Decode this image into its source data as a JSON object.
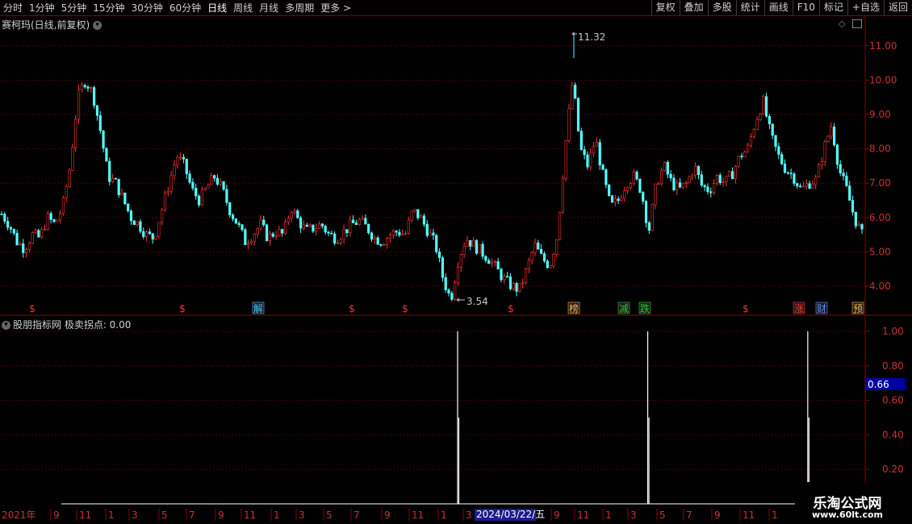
{
  "toolbar": {
    "periods": [
      "分时",
      "1分钟",
      "5分钟",
      "15分钟",
      "30分钟",
      "60分钟",
      "日线",
      "周线",
      "月线",
      "多周期",
      "更多 >"
    ],
    "active_period": "日线",
    "actions": [
      "复权",
      "叠加",
      "多股",
      "统计",
      "画线",
      "F10",
      "标记",
      "+自选",
      "返回"
    ]
  },
  "main_chart": {
    "title": "赛柯玛(日线,前复权)",
    "high_label": "11.32",
    "low_label": "3.54",
    "y_ticks": [
      "11.00",
      "10.00",
      "9.00",
      "8.00",
      "7.00",
      "6.00",
      "5.00",
      "4.00"
    ],
    "markers": [
      "$",
      "$",
      "解",
      "$",
      "$",
      "$",
      "榜",
      "减",
      "跌",
      "$",
      "涨",
      "财",
      "预"
    ]
  },
  "sub_chart": {
    "title": "股朋指标网 极卖拐点: 0.00",
    "y_ticks": [
      "1.00",
      "0.80",
      "0.60",
      "0.40",
      "0.20"
    ],
    "current_value": "0.66"
  },
  "date_axis": {
    "labels": [
      "2021年",
      "9",
      "11",
      "1",
      "3",
      "5",
      "7",
      "9",
      "11",
      "1",
      "3",
      "5",
      "7",
      "9",
      "11",
      "1",
      "3",
      "5",
      "7",
      "9",
      "11",
      "1",
      "3",
      "5",
      "7",
      "9",
      "11",
      "1"
    ],
    "cursor_date": "2024/03/22/五"
  },
  "watermark": {
    "line1": "乐淘公式网",
    "line2": "www.60lt.com"
  },
  "colors": {
    "up": "#ff3232",
    "down": "#54ffff",
    "grid": "#8b0000",
    "axis_text": "#c83232"
  },
  "chart_data": {
    "type": "candlestick+bar",
    "price_ylim": [
      3.5,
      11.5
    ],
    "price_path": [
      6.1,
      5.8,
      5.3,
      5.1,
      5.5,
      5.4,
      6.0,
      5.8,
      6.3,
      7.5,
      9.5,
      10.0,
      9.6,
      8.5,
      7.2,
      7.0,
      6.5,
      6.0,
      5.8,
      5.5,
      5.4,
      6.2,
      7.0,
      7.8,
      7.5,
      6.8,
      6.5,
      6.9,
      7.2,
      6.8,
      6.2,
      5.8,
      5.3,
      5.5,
      5.8,
      5.4,
      5.6,
      5.5,
      6.3,
      5.9,
      5.6,
      5.7,
      5.8,
      5.5,
      5.4,
      5.6,
      5.8,
      5.9,
      5.7,
      5.4,
      5.3,
      5.5,
      5.6,
      5.5,
      6.2,
      6.0,
      5.6,
      5.2,
      4.2,
      3.6,
      4.8,
      5.4,
      5.2,
      5.0,
      4.8,
      4.5,
      4.2,
      4.0,
      3.9,
      4.5,
      5.2,
      4.8,
      4.6,
      5.5,
      8.0,
      10.0,
      8.0,
      7.5,
      8.3,
      7.2,
      6.3,
      6.5,
      7.0,
      7.2,
      6.8,
      5.6,
      7.0,
      7.5,
      7.0,
      6.8,
      7.0,
      7.5,
      6.9,
      6.8,
      7.2,
      7.0,
      7.3,
      7.8,
      8.0,
      8.8,
      9.4,
      8.4,
      7.8,
      7.4,
      7.2,
      6.8,
      7.0,
      7.1,
      8.0,
      8.7,
      7.4,
      6.8,
      6.0,
      5.5
    ],
    "signal_x_fraction": [
      0.53,
      0.751,
      0.937
    ],
    "signal_values": [
      1.0,
      1.0,
      1.0
    ]
  }
}
